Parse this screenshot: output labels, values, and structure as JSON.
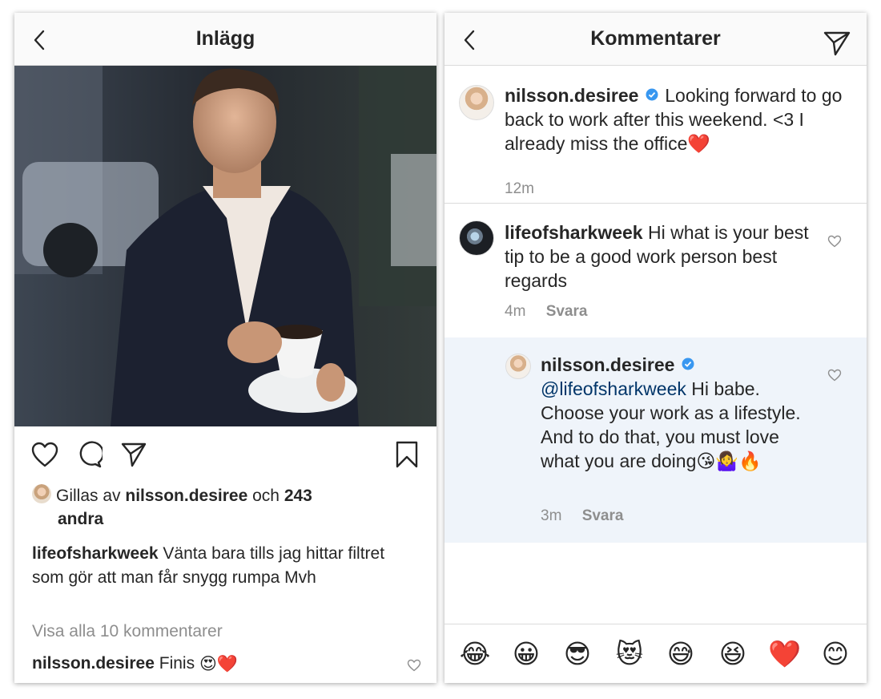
{
  "left": {
    "header": {
      "title": "Inlägg",
      "back_icon": "chevron-left-icon"
    },
    "likes": {
      "prefix": "Gillas av",
      "user": "nilsson.desiree",
      "mid": "och",
      "count": "243",
      "suffix": "andra"
    },
    "caption": {
      "user": "lifeofsharkweek",
      "text": "Vänta bara tills jag hittar filtret som gör att man får snygg rumpa Mvh"
    },
    "view_all": "Visa alla 10 kommentarer",
    "last_comment": {
      "user": "nilsson.desiree",
      "text": "Finis",
      "emojis": "😍❤️"
    },
    "icons": [
      "heart-icon",
      "comment-icon",
      "share-icon",
      "bookmark-icon"
    ]
  },
  "right": {
    "header": {
      "title": "Kommentarer",
      "back_icon": "chevron-left-icon",
      "send_icon": "paper-plane-icon"
    },
    "caption_comment": {
      "user": "nilsson.desiree",
      "text": "Looking forward to go back to work after this weekend. <3 I already miss the office",
      "emoji": "❤️",
      "time": "12m"
    },
    "comment": {
      "user": "lifeofsharkweek",
      "text": "Hi what is your best tip to be a good work person best regards",
      "time": "4m",
      "reply_label": "Svara"
    },
    "reply": {
      "user": "nilsson.desiree",
      "mention": "@lifeofsharkweek",
      "text": "Hi babe. Choose your work as a lifestyle. And to do that, you must love what you are doing",
      "emojis": "😘🤷‍♀️🔥",
      "time": "3m",
      "reply_label": "Svara"
    },
    "emoji_bar": [
      "😂",
      "😀",
      "😎",
      "😻",
      "😅",
      "😆",
      "❤️",
      "😊"
    ]
  },
  "colors": {
    "verified": "#3897f0",
    "mention": "#003569",
    "reply_bg": "#eff4fa",
    "muted": "#8e8e8e"
  }
}
